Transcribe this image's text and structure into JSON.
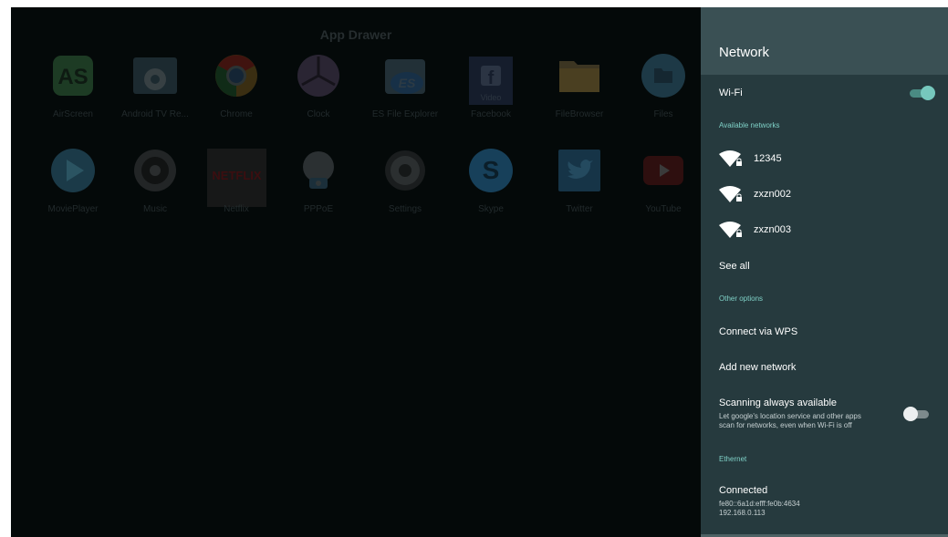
{
  "drawer": {
    "title": "App Drawer",
    "apps": [
      {
        "label": "AirScreen",
        "icon": "airscreen-icon"
      },
      {
        "label": "Android TV Re...",
        "icon": "android-tv-remote-icon"
      },
      {
        "label": "Chrome",
        "icon": "chrome-icon"
      },
      {
        "label": "Clock",
        "icon": "clock-icon"
      },
      {
        "label": "ES File Explorer",
        "icon": "es-file-explorer-icon"
      },
      {
        "label": "Facebook",
        "icon": "facebook-icon",
        "tile_caption": "Video"
      },
      {
        "label": "FileBrowser",
        "icon": "folder-icon"
      },
      {
        "label": "Files",
        "icon": "files-icon"
      },
      {
        "label": "MoviePlayer",
        "icon": "play-icon"
      },
      {
        "label": "Music",
        "icon": "speaker-icon"
      },
      {
        "label": "Netflix",
        "icon": "netflix-icon",
        "tile_text": "NETFLIX"
      },
      {
        "label": "PPPoE",
        "icon": "pppoe-globe-icon"
      },
      {
        "label": "Settings",
        "icon": "gear-icon"
      },
      {
        "label": "Skype",
        "icon": "skype-icon"
      },
      {
        "label": "Twitter",
        "icon": "twitter-icon"
      },
      {
        "label": "YouTube",
        "icon": "youtube-icon"
      }
    ]
  },
  "panel": {
    "title": "Network",
    "wifi": {
      "label": "Wi-Fi",
      "enabled": true
    },
    "available_networks": {
      "heading": "Available networks",
      "items": [
        {
          "name": "12345",
          "icon": "wifi-locked-icon"
        },
        {
          "name": "zxzn002",
          "icon": "wifi-locked-icon"
        },
        {
          "name": "zxzn003",
          "icon": "wifi-locked-icon"
        }
      ],
      "see_all": "See all"
    },
    "other_options": {
      "heading": "Other options",
      "connect_wps": "Connect via WPS",
      "add_network": "Add new network",
      "scanning": {
        "title": "Scanning always available",
        "description_line1": "Let google's location service and other apps",
        "description_line2": "scan for networks, even when Wi-Fi is off",
        "enabled": false
      }
    },
    "ethernet": {
      "heading": "Ethernet",
      "status": "Connected",
      "ipv6": "fe80::6a1d:efff:fe0b:4634",
      "ipv4": "192.168.0.113"
    }
  },
  "colors": {
    "accent": "#7fd1c7",
    "toggle_on": "#76c8bd",
    "panel_bg": "#263a3e",
    "header_bg": "#3a5054"
  }
}
